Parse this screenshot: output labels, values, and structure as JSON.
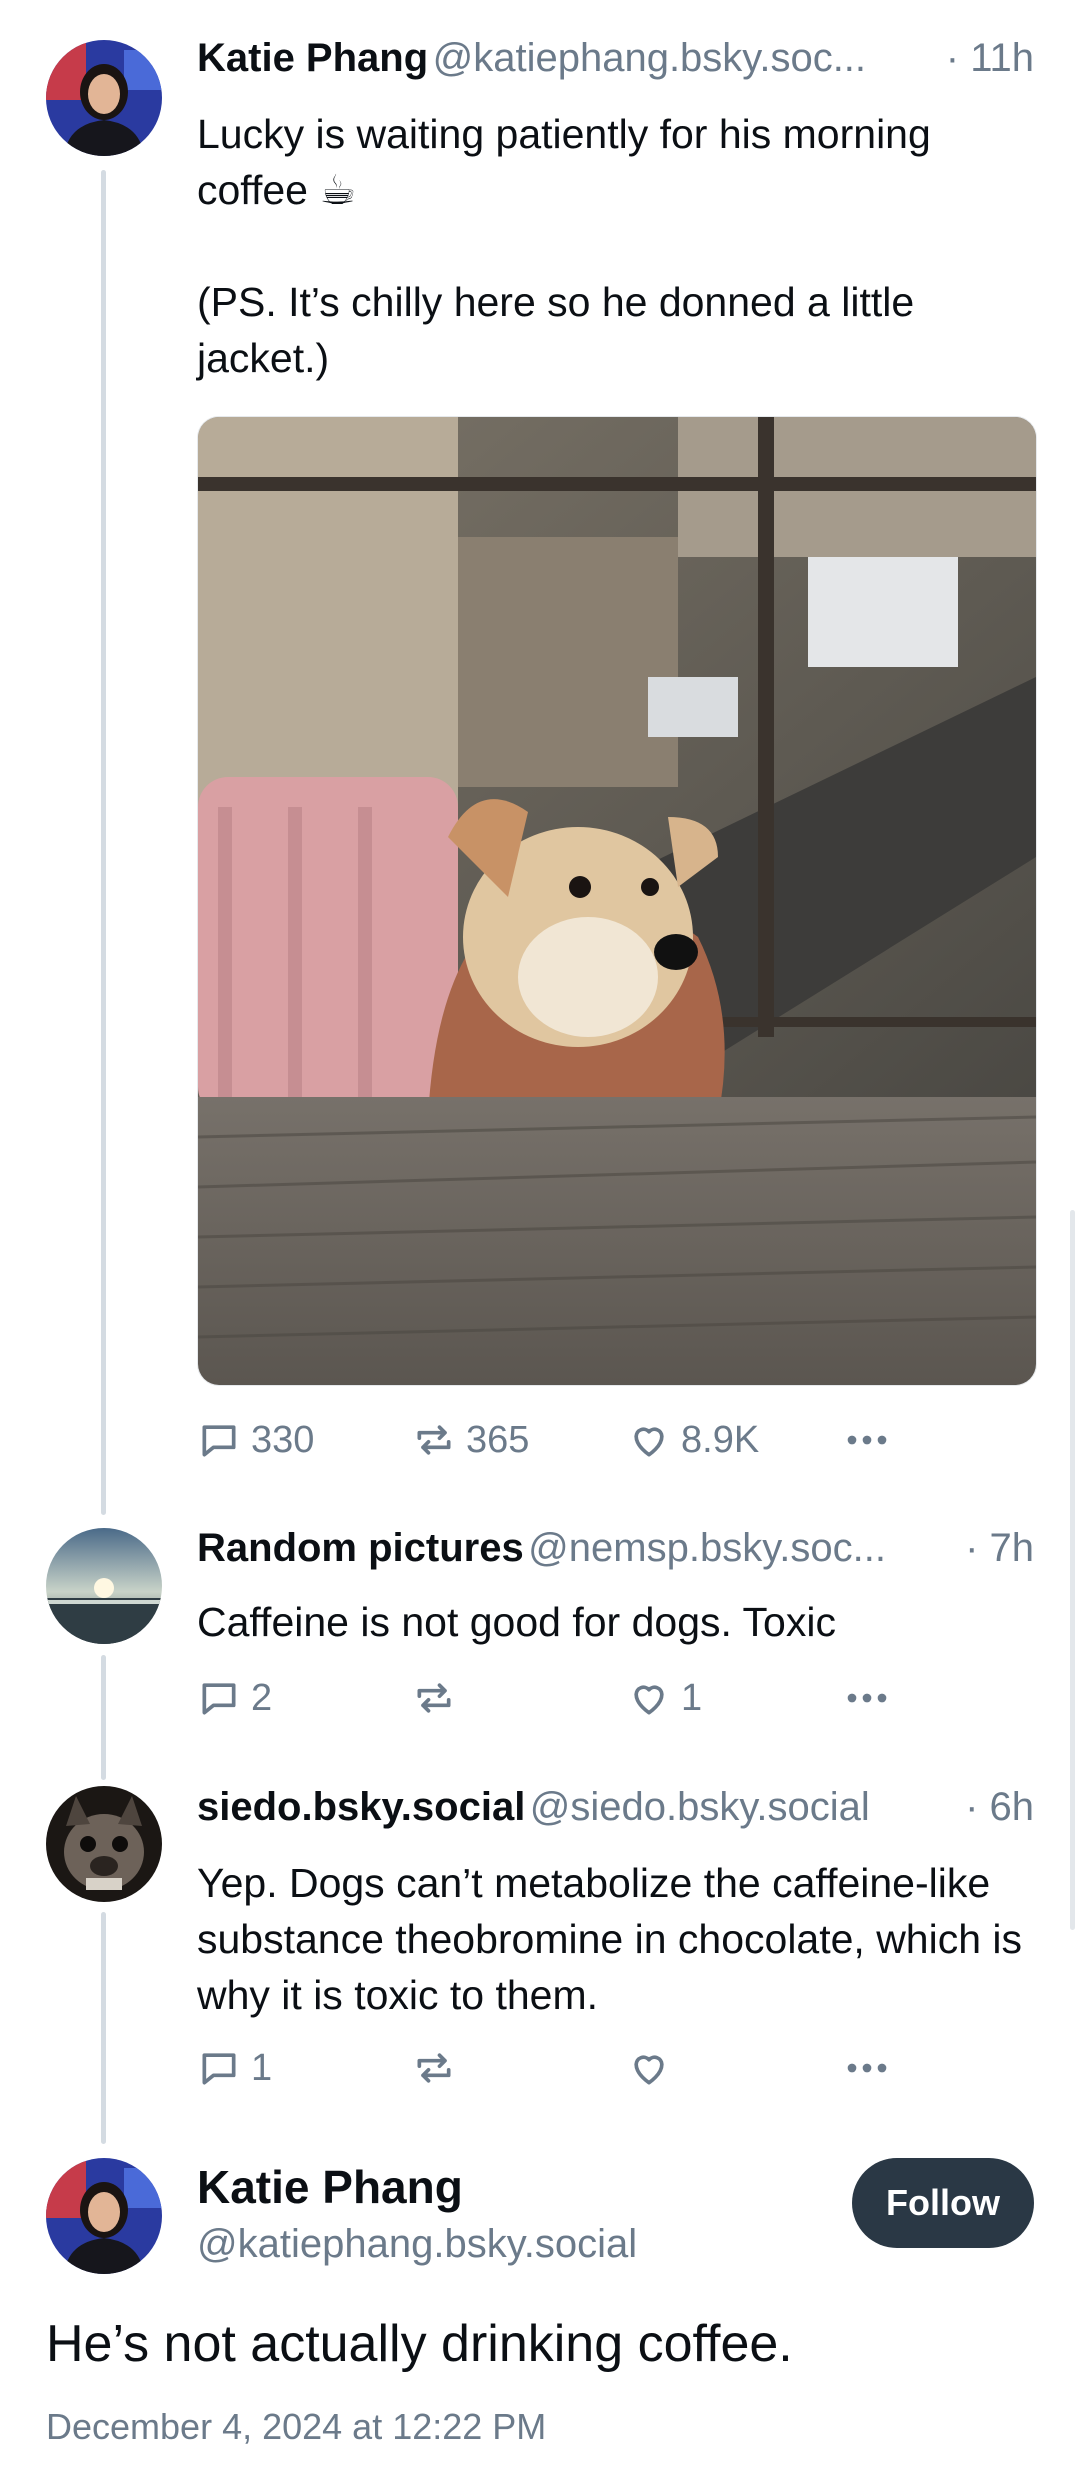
{
  "post1": {
    "author_name": "Katie Phang",
    "author_handle": "@katiephang.bsky.soc...",
    "time": "· 11h",
    "text_line1": "Lucky is waiting patiently for his morning coffee ☕",
    "text_line2": "(PS. It’s chilly here so he donned a little jacket.)",
    "replies": "330",
    "reposts": "365",
    "likes": "8.9K"
  },
  "reply1": {
    "author_name": "Random pictures",
    "author_handle": "@nemsp.bsky.soc...",
    "time": "· 7h",
    "text": "Caffeine is not good for dogs. Toxic",
    "replies": "2",
    "reposts": "",
    "likes": "1"
  },
  "reply2": {
    "author_name": "siedo.bsky.social",
    "author_handle": "@siedo.bsky.social",
    "time": "· 6h",
    "text": "Yep. Dogs can’t metabolize the caffeine-like substance theobromine in chocolate, which is why it is toxic to them.",
    "replies": "1",
    "reposts": "",
    "likes": ""
  },
  "main_post": {
    "author_name": "Katie Phang",
    "author_handle": "@katiephang.bsky.social",
    "follow_label": "Follow",
    "text": "He’s not actually drinking coffee.",
    "timestamp": "December 4, 2024 at 12:22 PM"
  },
  "colors": {
    "text": "#0b0f14",
    "muted": "#6b7a8a",
    "thread_line": "#d4dbe2",
    "follow_bg": "#2a3845"
  },
  "icons": [
    "reply-icon",
    "repost-icon",
    "like-icon",
    "more-icon"
  ]
}
